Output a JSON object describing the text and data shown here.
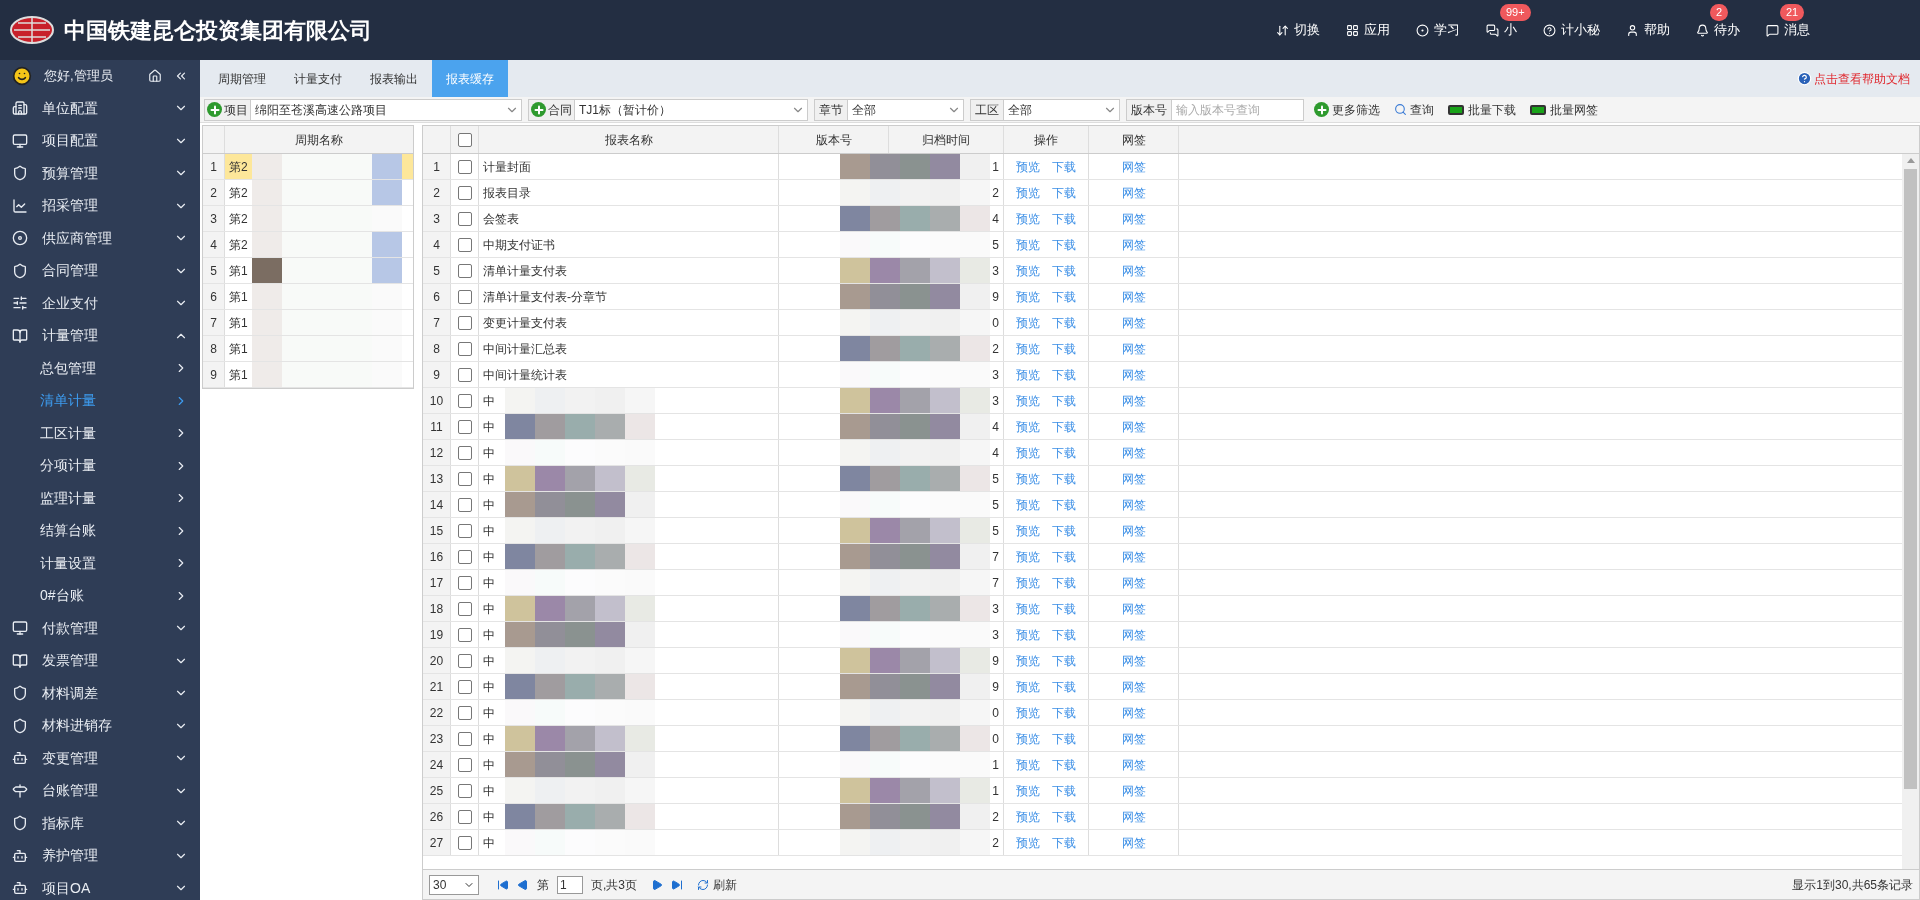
{
  "header": {
    "title": "中国铁建昆仑投资集团有限公司",
    "nav": [
      {
        "label": "切换",
        "kind": "switch"
      },
      {
        "label": "应用",
        "kind": "apps"
      },
      {
        "label": "学习",
        "kind": "learn"
      },
      {
        "label": "小",
        "kind": "chat",
        "badge": "99+"
      },
      {
        "label": "计小秘",
        "kind": "help-circle"
      },
      {
        "label": "帮助",
        "kind": "user"
      },
      {
        "label": "待办",
        "kind": "bell",
        "badge": "2"
      },
      {
        "label": "消息",
        "kind": "message",
        "badge": "21"
      }
    ]
  },
  "sidebar": {
    "greeting": "您好,管理员",
    "items": [
      {
        "label": "单位配置",
        "expanded": false
      },
      {
        "label": "项目配置",
        "expanded": false
      },
      {
        "label": "预算管理",
        "expanded": false
      },
      {
        "label": "招采管理",
        "expanded": false
      },
      {
        "label": "供应商管理",
        "expanded": false
      },
      {
        "label": "合同管理",
        "expanded": false
      },
      {
        "label": "企业支付",
        "expanded": false
      },
      {
        "label": "计量管理",
        "expanded": true,
        "children": [
          {
            "label": "总包管理",
            "selected": false
          },
          {
            "label": "清单计量",
            "selected": true
          },
          {
            "label": "工区计量",
            "selected": false
          },
          {
            "label": "分项计量",
            "selected": false
          },
          {
            "label": "监理计量",
            "selected": false
          },
          {
            "label": "结算台账",
            "selected": false
          },
          {
            "label": "计量设置",
            "selected": false
          },
          {
            "label": "0#台账",
            "selected": false
          }
        ]
      },
      {
        "label": "付款管理",
        "expanded": false
      },
      {
        "label": "发票管理",
        "expanded": false
      },
      {
        "label": "材料调差",
        "expanded": false
      },
      {
        "label": "材料进销存",
        "expanded": false
      },
      {
        "label": "变更管理",
        "expanded": false
      },
      {
        "label": "台账管理",
        "expanded": false
      },
      {
        "label": "指标库",
        "expanded": false
      },
      {
        "label": "养护管理",
        "expanded": false
      },
      {
        "label": "项目OA",
        "expanded": false
      }
    ]
  },
  "tabs": [
    {
      "label": "周期管理",
      "selected": false
    },
    {
      "label": "计量支付",
      "selected": false
    },
    {
      "label": "报表输出",
      "selected": false
    },
    {
      "label": "报表缓存",
      "selected": true
    }
  ],
  "help_link": "点击查看帮助文档",
  "filters": {
    "project_label": "项目",
    "project_value": "绵阳至苍溪高速公路项目",
    "contract_label": "合同",
    "contract_value": "TJ1标（暂计价）",
    "chapter_label": "章节",
    "chapter_value": "全部",
    "area_label": "工区",
    "area_value": "全部",
    "version_label": "版本号",
    "version_placeholder": "输入版本号查询",
    "more": "更多筛选",
    "query": "查询",
    "batch_download": "批量下载",
    "batch_sign": "批量网签"
  },
  "period_table": {
    "columns": [
      "周期名称"
    ],
    "rows": [
      {
        "index": "1",
        "name": "第2",
        "selected": true
      },
      {
        "index": "2",
        "name": "第2",
        "selected": false
      },
      {
        "index": "3",
        "name": "第2",
        "selected": false
      },
      {
        "index": "4",
        "name": "第2",
        "selected": false
      },
      {
        "index": "5",
        "name": "第1",
        "selected": false
      },
      {
        "index": "6",
        "name": "第1",
        "selected": false
      },
      {
        "index": "7",
        "name": "第1",
        "selected": false
      },
      {
        "index": "8",
        "name": "第1",
        "selected": false
      },
      {
        "index": "9",
        "name": "第1",
        "selected": false
      }
    ]
  },
  "report_table": {
    "select_all_checked": false,
    "columns": [
      "报表名称",
      "版本号",
      "归档时间",
      "操作",
      "网签"
    ],
    "rows": [
      {
        "index": "1",
        "checked": false,
        "name": "计量封面",
        "time": "1",
        "preview": "预览",
        "download": "下载",
        "sign": "网签"
      },
      {
        "index": "2",
        "checked": false,
        "name": "报表目录",
        "time": "2",
        "preview": "预览",
        "download": "下载",
        "sign": "网签"
      },
      {
        "index": "3",
        "checked": false,
        "name": "会签表",
        "time": "4",
        "preview": "预览",
        "download": "下载",
        "sign": "网签"
      },
      {
        "index": "4",
        "checked": false,
        "name": "中期支付证书",
        "time": "5",
        "preview": "预览",
        "download": "下载",
        "sign": "网签"
      },
      {
        "index": "5",
        "checked": false,
        "name": "清单计量支付表",
        "time": "3",
        "preview": "预览",
        "download": "下载",
        "sign": "网签"
      },
      {
        "index": "6",
        "checked": false,
        "name": "清单计量支付表-分章节",
        "time": "9",
        "preview": "预览",
        "download": "下载",
        "sign": "网签"
      },
      {
        "index": "7",
        "checked": false,
        "name": "变更计量支付表",
        "time": "0",
        "preview": "预览",
        "download": "下载",
        "sign": "网签"
      },
      {
        "index": "8",
        "checked": false,
        "name": "中间计量汇总表",
        "time": "2",
        "preview": "预览",
        "download": "下载",
        "sign": "网签"
      },
      {
        "index": "9",
        "checked": false,
        "name": "中间计量统计表",
        "time": "3",
        "preview": "预览",
        "download": "下载",
        "sign": "网签"
      },
      {
        "index": "10",
        "checked": false,
        "name": "中",
        "time": "3",
        "preview": "预览",
        "download": "下载",
        "sign": "网签"
      },
      {
        "index": "11",
        "checked": false,
        "name": "中",
        "time": "4",
        "preview": "预览",
        "download": "下载",
        "sign": "网签"
      },
      {
        "index": "12",
        "checked": false,
        "name": "中",
        "time": "4",
        "preview": "预览",
        "download": "下载",
        "sign": "网签"
      },
      {
        "index": "13",
        "checked": false,
        "name": "中",
        "time": "5",
        "preview": "预览",
        "download": "下载",
        "sign": "网签"
      },
      {
        "index": "14",
        "checked": false,
        "name": "中",
        "time": "5",
        "preview": "预览",
        "download": "下载",
        "sign": "网签"
      },
      {
        "index": "15",
        "checked": false,
        "name": "中",
        "time": "5",
        "preview": "预览",
        "download": "下载",
        "sign": "网签"
      },
      {
        "index": "16",
        "checked": false,
        "name": "中",
        "time": "7",
        "preview": "预览",
        "download": "下载",
        "sign": "网签"
      },
      {
        "index": "17",
        "checked": false,
        "name": "中",
        "time": "7",
        "preview": "预览",
        "download": "下载",
        "sign": "网签"
      },
      {
        "index": "18",
        "checked": false,
        "name": "中",
        "time": "3",
        "preview": "预览",
        "download": "下载",
        "sign": "网签"
      },
      {
        "index": "19",
        "checked": false,
        "name": "中",
        "time": "3",
        "preview": "预览",
        "download": "下载",
        "sign": "网签"
      },
      {
        "index": "20",
        "checked": false,
        "name": "中",
        "time": "9",
        "preview": "预览",
        "download": "下载",
        "sign": "网签"
      },
      {
        "index": "21",
        "checked": false,
        "name": "中",
        "time": "9",
        "preview": "预览",
        "download": "下载",
        "sign": "网签"
      },
      {
        "index": "22",
        "checked": false,
        "name": "中",
        "time": "0",
        "preview": "预览",
        "download": "下载",
        "sign": "网签"
      },
      {
        "index": "23",
        "checked": false,
        "name": "中",
        "time": "0",
        "preview": "预览",
        "download": "下载",
        "sign": "网签"
      },
      {
        "index": "24",
        "checked": false,
        "name": "中",
        "time": "1",
        "preview": "预览",
        "download": "下载",
        "sign": "网签"
      },
      {
        "index": "25",
        "checked": false,
        "name": "中",
        "time": "1",
        "preview": "预览",
        "download": "下载",
        "sign": "网签"
      },
      {
        "index": "26",
        "checked": false,
        "name": "中",
        "time": "2",
        "preview": "预览",
        "download": "下载",
        "sign": "网签"
      },
      {
        "index": "27",
        "checked": false,
        "name": "中",
        "time": "2",
        "preview": "预览",
        "download": "下载",
        "sign": "网签"
      }
    ]
  },
  "pager": {
    "page_size": "30",
    "page_prefix": "第",
    "page": "1",
    "page_suffix": "页,共3页",
    "refresh": "刷新",
    "summary": "显示1到30,共65条记录"
  }
}
